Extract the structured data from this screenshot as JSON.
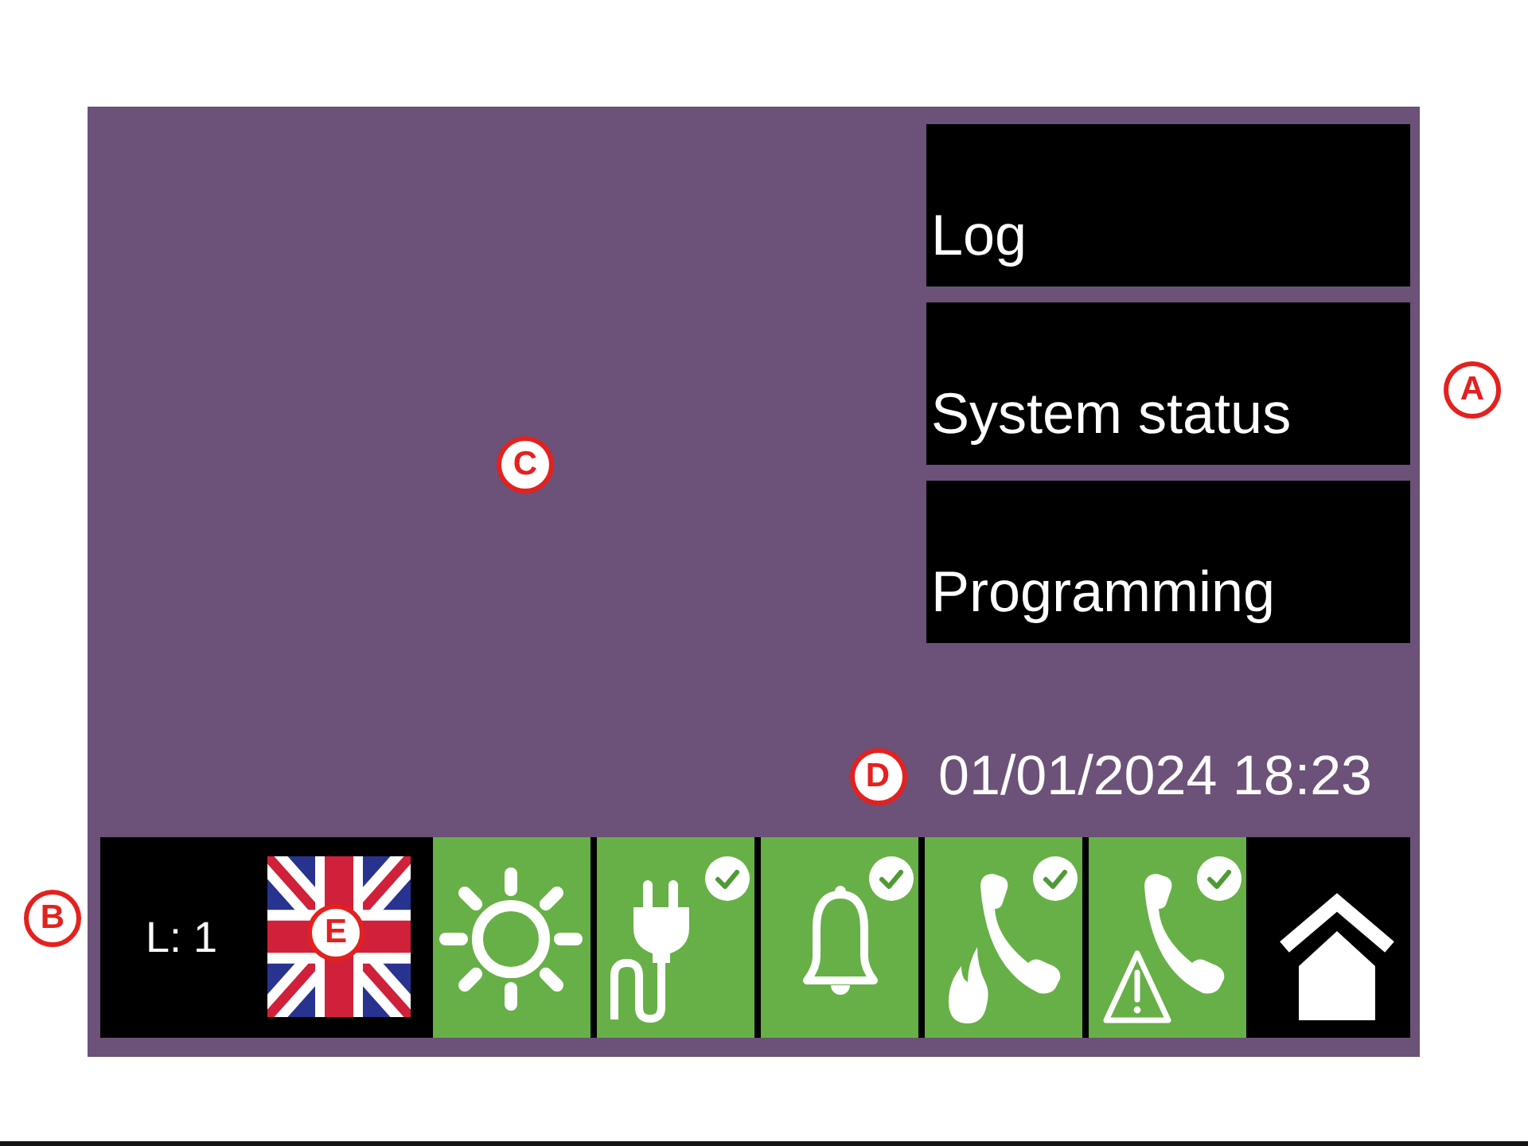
{
  "screen": {
    "callout": "C"
  },
  "menu": {
    "callout": "A",
    "items": [
      {
        "label": "Log"
      },
      {
        "label": "System status"
      },
      {
        "label": "Programming"
      }
    ]
  },
  "datetime": {
    "text": "01/01/2024 18:23",
    "callout": "D"
  },
  "status_bar": {
    "user_level": {
      "label": "L: 1",
      "callout": "B"
    },
    "language": {
      "callout": "E"
    },
    "tiles": [
      {
        "kind": "sun",
        "checked": false
      },
      {
        "kind": "plug",
        "checked": true
      },
      {
        "kind": "bell",
        "checked": true
      },
      {
        "kind": "phone-fire",
        "checked": true
      },
      {
        "kind": "phone-warning",
        "checked": true
      }
    ]
  }
}
